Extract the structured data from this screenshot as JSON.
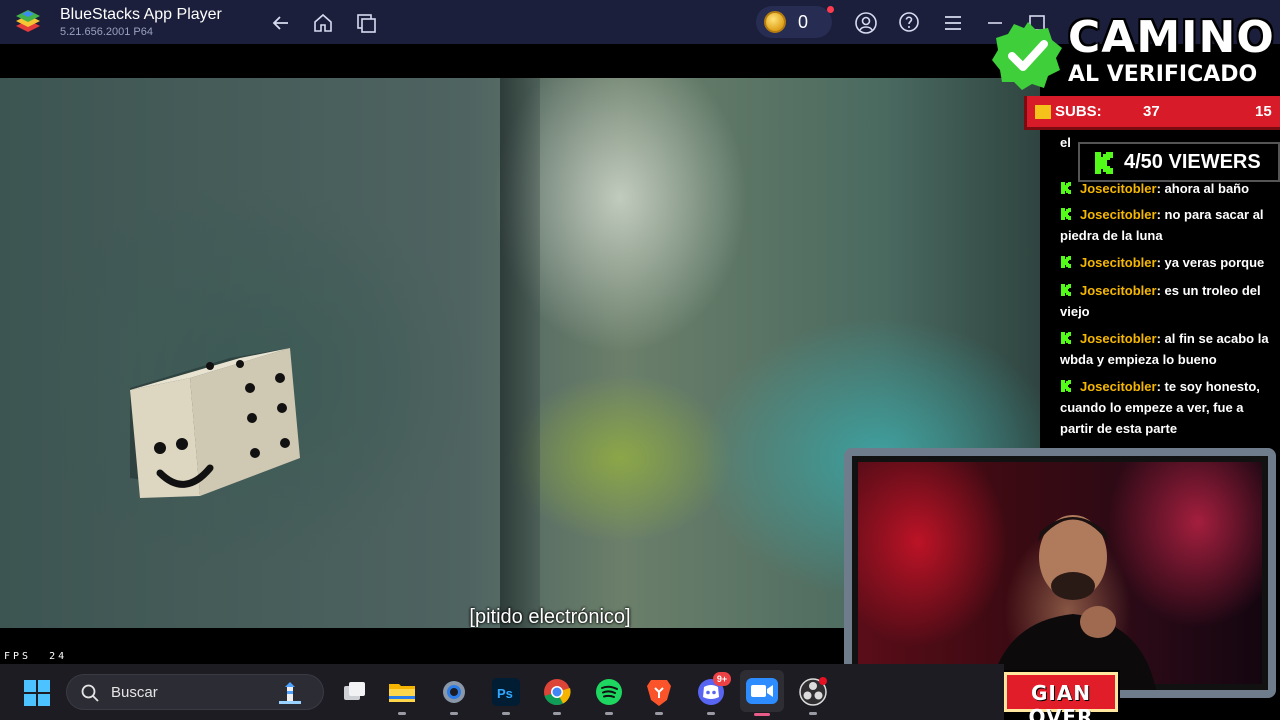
{
  "titlebar": {
    "app_name": "BlueStacks App Player",
    "version": "5.21.656.2001 P64",
    "coins": "0",
    "icons": [
      "back-icon",
      "home-icon",
      "multi-instance-icon",
      "account-icon",
      "help-icon",
      "menu-icon",
      "minimize-icon",
      "maximize-icon",
      "close-icon"
    ]
  },
  "video": {
    "subtitle": "[pitido electrónico]"
  },
  "fps": {
    "label": "FPS",
    "value": "24"
  },
  "overlay": {
    "title_line1": "CAMINO",
    "title_line2": "AL VERIFICADO",
    "subs_label": "SUBS:",
    "subs_current": "37",
    "subs_goal": "15",
    "viewers": "4/50 VIEWERS",
    "accent_color": "#d81b28",
    "check_color": "#3ecf3a",
    "kick_color": "#53fc18"
  },
  "chat": {
    "partial_top": "el",
    "messages": [
      {
        "user": "Josecitobler",
        "text": ": ahora al baño"
      },
      {
        "user": "Josecitobler",
        "text": ": no para sacar al piedra de la luna"
      },
      {
        "user": "Josecitobler",
        "text": ": ya veras porque"
      },
      {
        "user": "Josecitobler",
        "text": ": es un troleo del viejo"
      },
      {
        "user": "Josecitobler",
        "text": ": al fin se acabo la wbda y empieza lo bueno"
      },
      {
        "user": "Josecitobler",
        "text": ": te soy honesto, cuando lo empeze a ver, fue a partir de esta parte"
      }
    ]
  },
  "webcam": {
    "name_tag": "GIAN OVER"
  },
  "taskbar": {
    "search_placeholder": "Buscar",
    "apps": [
      "task-view",
      "file-explorer",
      "settings",
      "photoshop",
      "chrome",
      "spotify",
      "brave",
      "discord",
      "zoom",
      "obs"
    ],
    "discord_badge": "9+"
  }
}
